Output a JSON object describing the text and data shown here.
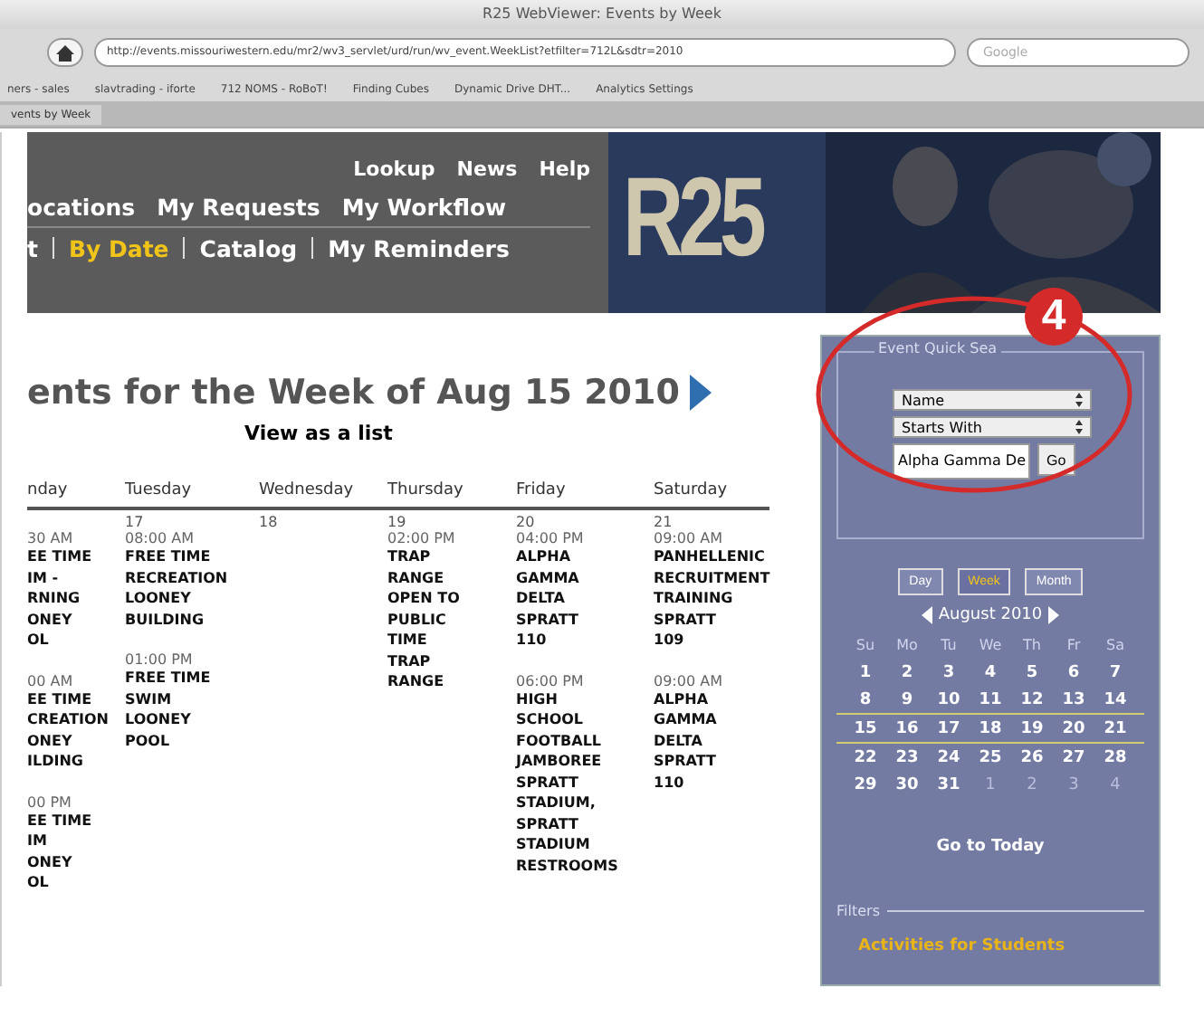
{
  "window": {
    "title": "R25 WebViewer: Events by Week"
  },
  "toolbar": {
    "url": "http://events.missouriwestern.edu/mr2/wv3_servlet/urd/run/wv_event.WeekList?etfilter=712L&sdtr=2010",
    "search_placeholder": "Google"
  },
  "bookmarks": [
    "ners - sales",
    "slavtrading - iforte",
    "712 NOMS - RoBoT!",
    "Finding Cubes",
    "Dynamic Drive DHT...",
    "Analytics Settings"
  ],
  "tab": {
    "label": "vents by Week"
  },
  "header": {
    "top_links": [
      "Lookup",
      "News",
      "Help"
    ],
    "middle_links": [
      "ocations",
      "My Requests",
      "My Workflow"
    ],
    "bottom_links": [
      {
        "label": "t",
        "selected": false
      },
      {
        "label": "By Date",
        "selected": true
      },
      {
        "label": "Catalog",
        "selected": false
      },
      {
        "label": "My Reminders",
        "selected": false
      }
    ],
    "logo": "R25"
  },
  "heading": "ents for the Week of Aug 15 2010",
  "list_link": "View as a list",
  "days": [
    {
      "name": "nday",
      "events": [
        {
          "time": "30 AM",
          "lines": [
            "EE TIME",
            "IM -",
            "RNING",
            "ONEY",
            "OL"
          ]
        },
        {
          "time": "00 AM",
          "lines": [
            "EE TIME",
            "CREATION",
            "ONEY",
            "ILDING"
          ]
        },
        {
          "time": "00 PM",
          "lines": [
            "EE TIME",
            "IM",
            "ONEY",
            "OL"
          ]
        }
      ]
    },
    {
      "name": "Tuesday",
      "date": "17",
      "events": [
        {
          "time": "08:00 AM",
          "lines": [
            "FREE TIME",
            "RECREATION",
            "LOONEY",
            "BUILDING"
          ]
        },
        {
          "time": "01:00 PM",
          "lines": [
            "FREE TIME",
            "SWIM",
            "LOONEY",
            "POOL"
          ]
        }
      ]
    },
    {
      "name": "Wednesday",
      "date": "18"
    },
    {
      "name": "Thursday",
      "date": "19",
      "events": [
        {
          "time": "02:00 PM",
          "lines": [
            "TRAP",
            "RANGE",
            "OPEN TO",
            "PUBLIC",
            "TIME",
            "TRAP",
            "RANGE"
          ]
        }
      ]
    },
    {
      "name": "Friday",
      "date": "20",
      "events": [
        {
          "time": "04:00 PM",
          "lines": [
            "ALPHA",
            "GAMMA",
            "DELTA",
            "SPRATT",
            "110"
          ]
        },
        {
          "time": "06:00 PM",
          "lines": [
            "HIGH",
            "SCHOOL",
            "FOOTBALL",
            "JAMBOREE",
            "SPRATT",
            "STADIUM,",
            "SPRATT",
            "STADIUM",
            "RESTROOMS"
          ]
        }
      ]
    },
    {
      "name": "Saturday",
      "date": "21",
      "events": [
        {
          "time": "09:00 AM",
          "lines": [
            "PANHELLENIC",
            "RECRUITMENT",
            "TRAINING",
            "SPRATT",
            "109"
          ]
        },
        {
          "time": "09:00 AM",
          "lines": [
            "ALPHA",
            "GAMMA",
            "DELTA",
            "SPRATT",
            "110"
          ]
        }
      ]
    }
  ],
  "quick_search": {
    "legend": "Event Quick Sea",
    "field": "Name",
    "match": "Starts With",
    "value": "Alpha Gamma De",
    "go": "Go"
  },
  "badge": "4",
  "views": [
    {
      "label": "Day",
      "selected": false
    },
    {
      "label": "Week",
      "selected": true
    },
    {
      "label": "Month",
      "selected": false
    }
  ],
  "month": "August 2010",
  "weekdays": [
    "Su",
    "Mo",
    "Tu",
    "We",
    "Th",
    "Fr",
    "Sa"
  ],
  "weeks": [
    {
      "selected": false,
      "days": [
        {
          "d": "1",
          "other": false
        },
        {
          "d": "2",
          "other": false
        },
        {
          "d": "3",
          "other": false
        },
        {
          "d": "4",
          "other": false
        },
        {
          "d": "5",
          "other": false
        },
        {
          "d": "6",
          "other": false
        },
        {
          "d": "7",
          "other": false
        }
      ]
    },
    {
      "selected": false,
      "days": [
        {
          "d": "8",
          "other": false
        },
        {
          "d": "9",
          "other": false
        },
        {
          "d": "10",
          "other": false
        },
        {
          "d": "11",
          "other": false
        },
        {
          "d": "12",
          "other": false
        },
        {
          "d": "13",
          "other": false
        },
        {
          "d": "14",
          "other": false
        }
      ]
    },
    {
      "selected": true,
      "days": [
        {
          "d": "15",
          "other": false
        },
        {
          "d": "16",
          "other": false
        },
        {
          "d": "17",
          "other": false
        },
        {
          "d": "18",
          "other": false
        },
        {
          "d": "19",
          "other": false
        },
        {
          "d": "20",
          "other": false
        },
        {
          "d": "21",
          "other": false
        }
      ]
    },
    {
      "selected": false,
      "days": [
        {
          "d": "22",
          "other": false
        },
        {
          "d": "23",
          "other": false
        },
        {
          "d": "24",
          "other": false
        },
        {
          "d": "25",
          "other": false
        },
        {
          "d": "26",
          "other": false
        },
        {
          "d": "27",
          "other": false
        },
        {
          "d": "28",
          "other": false
        }
      ]
    },
    {
      "selected": false,
      "days": [
        {
          "d": "29",
          "other": false
        },
        {
          "d": "30",
          "other": false
        },
        {
          "d": "31",
          "other": false
        },
        {
          "d": "1",
          "other": true
        },
        {
          "d": "2",
          "other": true
        },
        {
          "d": "3",
          "other": true
        },
        {
          "d": "4",
          "other": true
        }
      ]
    }
  ],
  "today": "Go to Today",
  "filters": {
    "legend": "Filters",
    "link": "Activities for Students"
  }
}
